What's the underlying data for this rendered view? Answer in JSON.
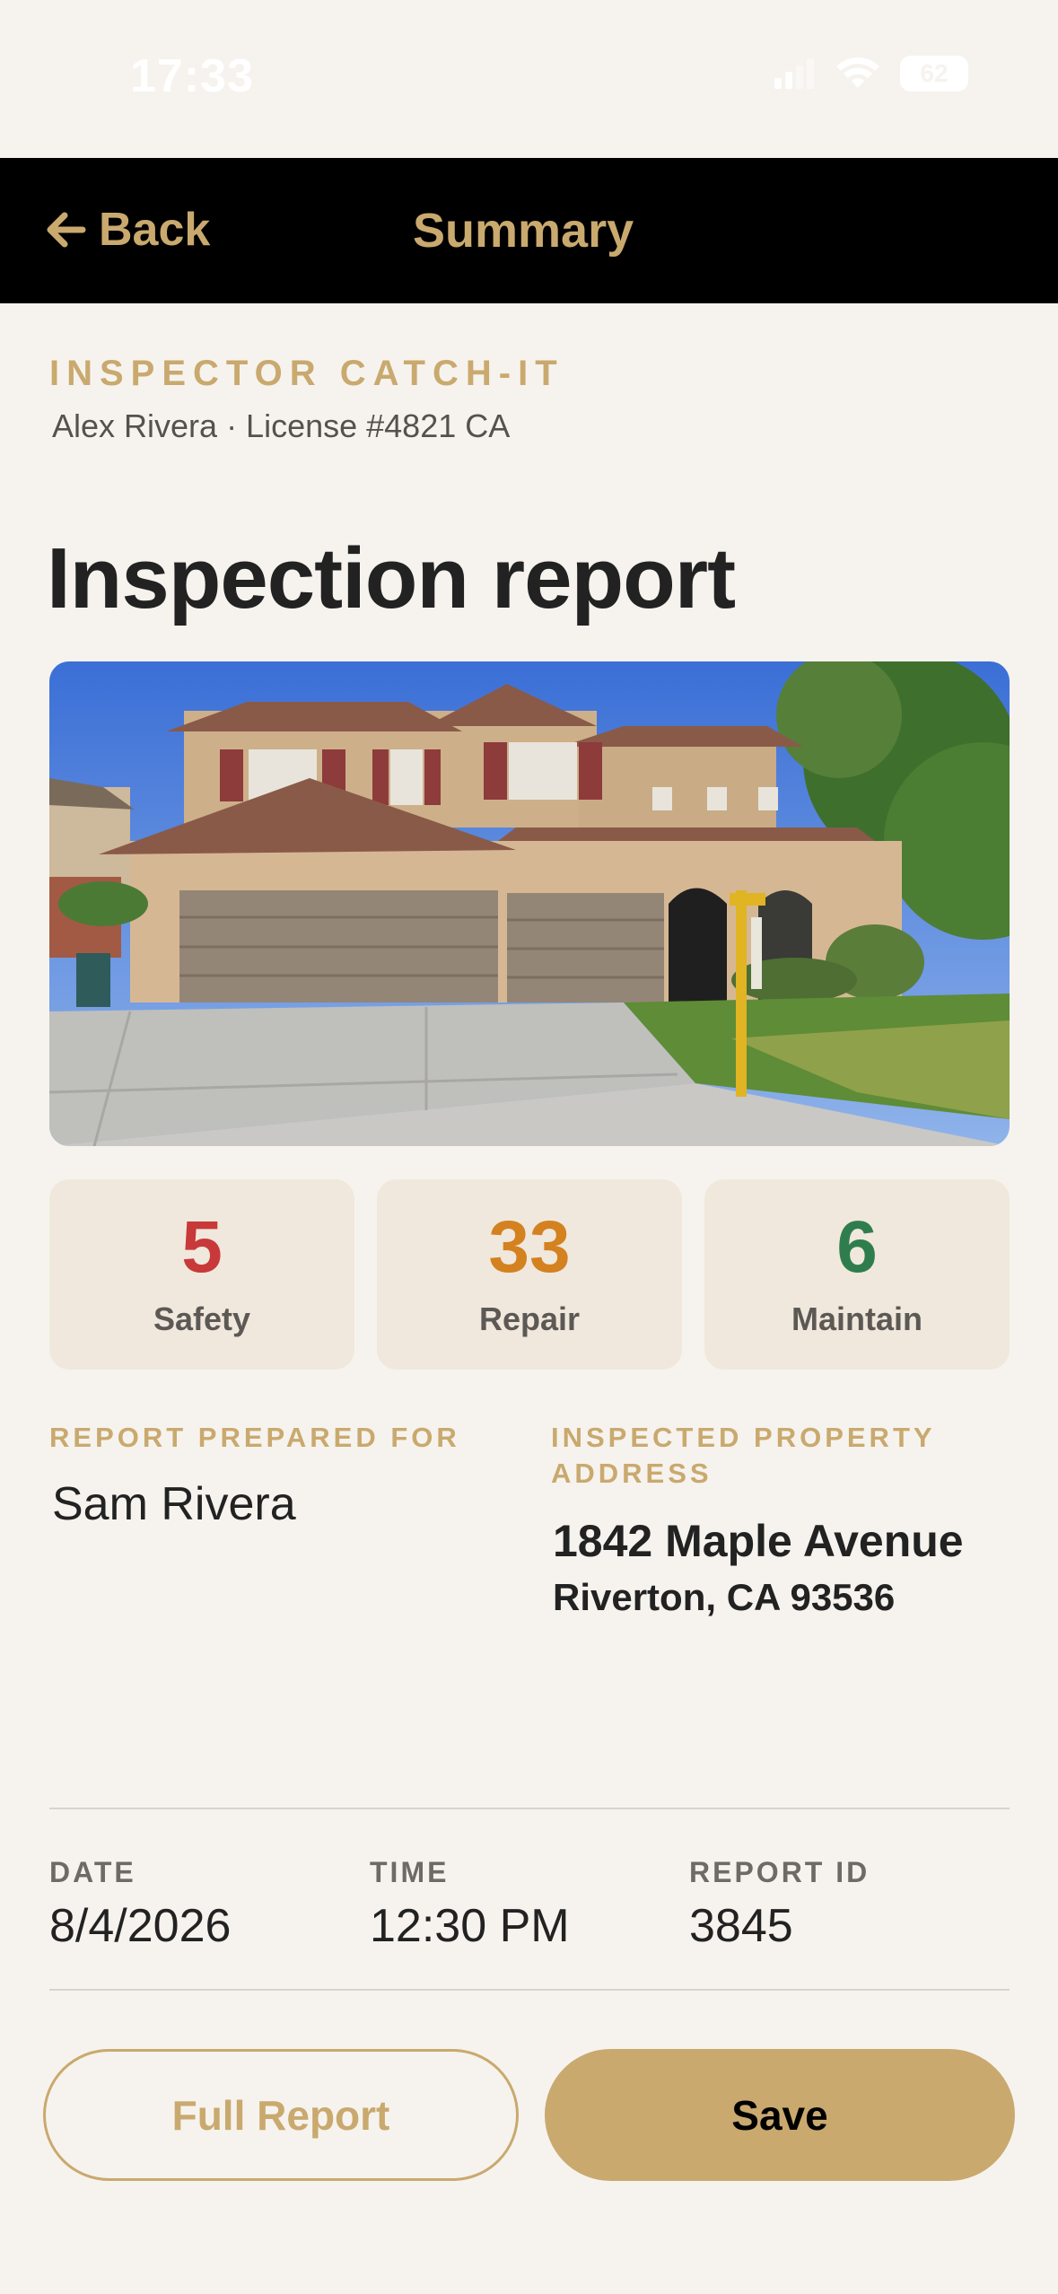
{
  "status_bar": {
    "time": "17:33",
    "battery": "62"
  },
  "nav": {
    "back_label": "Back",
    "title": "Summary"
  },
  "company": "INSPECTOR CATCH-IT",
  "inspector_line": "Alex Rivera · License #4821 CA",
  "report_title": "Inspection report",
  "counts": [
    {
      "value": "5",
      "label": "Safety",
      "color": "#c8393a"
    },
    {
      "value": "33",
      "label": "Repair",
      "color": "#d4811f"
    },
    {
      "value": "6",
      "label": "Maintain",
      "color": "#2f7d4c"
    }
  ],
  "prepared_for": {
    "label": "REPORT PREPARED FOR",
    "name": "Sam Rivera"
  },
  "property": {
    "label": "INSPECTED PROPERTY ADDRESS",
    "line1": "1842 Maple Avenue",
    "line2": "Riverton, CA 93536"
  },
  "meta": {
    "date_label": "DATE",
    "date": "8/4/2026",
    "time_label": "TIME",
    "time": "12:30 PM",
    "id_label": "REPORT ID",
    "id": "3845"
  },
  "buttons": {
    "full_report": "Full Report",
    "save": "Save"
  },
  "colors": {
    "accent": "#c9a96e",
    "background": "#f6f3ee"
  }
}
